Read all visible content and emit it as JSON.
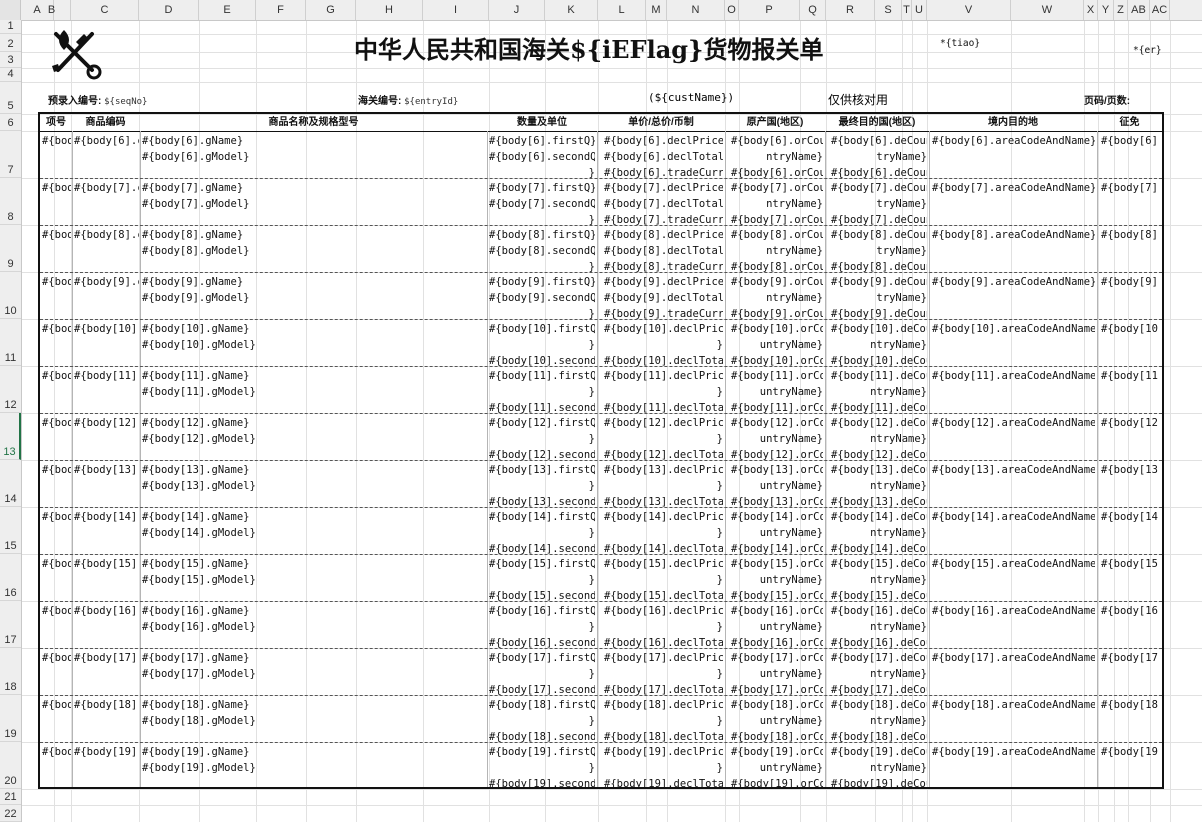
{
  "column_headers": [
    "A",
    "B",
    "C",
    "D",
    "E",
    "F",
    "G",
    "H",
    "I",
    "J",
    "K",
    "L",
    "M",
    "N",
    "O",
    "P",
    "Q",
    "R",
    "S",
    "T",
    "U",
    "V",
    "W",
    "X",
    "Y",
    "Z",
    "AB",
    "AC"
  ],
  "row_headers": [
    "1",
    "2",
    "3",
    "4",
    "5",
    "6",
    "7",
    "8",
    "9",
    "10",
    "11",
    "12",
    "13",
    "14",
    "15",
    "16",
    "17",
    "18",
    "19",
    "20",
    "21",
    "22"
  ],
  "selected_row": "13",
  "document": {
    "title": "中华人民共和国海关${iEFlag}货物报关单",
    "tiao": "*{tiao}",
    "er": "*{er}",
    "seq_label": "预录入编号:",
    "seq_value": "${seqNo}",
    "entry_label": "海关编号:",
    "entry_value": "${entryId}",
    "cust_name": "(${custName})",
    "verify_note": "仅供核对用",
    "page_label": "页码/页数:"
  },
  "table": {
    "headers": [
      "项号",
      "商品编码",
      "商品名称及规格型号",
      "数量及单位",
      "单价/总价/币制",
      "原产国(地区)",
      "最终目的国(地区)",
      "境内目的地",
      "征免"
    ],
    "rows": [
      {
        "c0": "#{bod",
        "c1": "#{body[6].c",
        "c2a": "#{body[6].gName}",
        "c2b": "#{body[6].gModel}",
        "c3a": "#{body[6].firstQ}",
        "c3b": "#{body[6].secondQ",
        "c3c": "}",
        "c4a": "#{body[6].declPrice}",
        "c4b": "#{body[6].declTotal}",
        "c4c": "#{body[6].tradeCurrN",
        "c5a": "#{body[6].orCou",
        "c5b": "ntryName}",
        "c5c": "#{body[6].orCou",
        "c6a": "#{body[6].deCoun",
        "c6b": "tryName}",
        "c6c": "#{body[6].deCoun",
        "c7": "#{body[6].areaCodeAndName}",
        "c8": "#{body[6]."
      },
      {
        "c0": "#{bod",
        "c1": "#{body[7].c",
        "c2a": "#{body[7].gName}",
        "c2b": "#{body[7].gModel}",
        "c3a": "#{body[7].firstQ}",
        "c3b": "#{body[7].secondQ",
        "c3c": "}",
        "c4a": "#{body[7].declPrice}",
        "c4b": "#{body[7].declTotal}",
        "c4c": "#{body[7].tradeCurrN",
        "c5a": "#{body[7].orCou",
        "c5b": "ntryName}",
        "c5c": "#{body[7].orCou",
        "c6a": "#{body[7].deCoun",
        "c6b": "tryName}",
        "c6c": "#{body[7].deCoun",
        "c7": "#{body[7].areaCodeAndName}",
        "c8": "#{body[7]."
      },
      {
        "c0": "#{bod",
        "c1": "#{body[8].c",
        "c2a": "#{body[8].gName}",
        "c2b": "#{body[8].gModel}",
        "c3a": "#{body[8].firstQ}",
        "c3b": "#{body[8].secondQ",
        "c3c": "}",
        "c4a": "#{body[8].declPrice}",
        "c4b": "#{body[8].declTotal}",
        "c4c": "#{body[8].tradeCurrN",
        "c5a": "#{body[8].orCou",
        "c5b": "ntryName}",
        "c5c": "#{body[8].orCou",
        "c6a": "#{body[8].deCoun",
        "c6b": "tryName}",
        "c6c": "#{body[8].deCoun",
        "c7": "#{body[8].areaCodeAndName}",
        "c8": "#{body[8]."
      },
      {
        "c0": "#{bod",
        "c1": "#{body[9].c",
        "c2a": "#{body[9].gName}",
        "c2b": "#{body[9].gModel}",
        "c3a": "#{body[9].firstQ}",
        "c3b": "#{body[9].secondQ",
        "c3c": "}",
        "c4a": "#{body[9].declPrice}",
        "c4b": "#{body[9].declTotal}",
        "c4c": "#{body[9].tradeCurrN",
        "c5a": "#{body[9].orCou",
        "c5b": "ntryName}",
        "c5c": "#{body[9].orCou",
        "c6a": "#{body[9].deCoun",
        "c6b": "tryName}",
        "c6c": "#{body[9].deCoun",
        "c7": "#{body[9].areaCodeAndName}",
        "c8": "#{body[9]."
      },
      {
        "c0": "#{bod",
        "c1": "#{body[10].",
        "c2a": "#{body[10].gName}",
        "c2b": "#{body[10].gModel}",
        "c3a": "#{body[10].firstQ",
        "c3b": "}",
        "c3c": "#{body[10].second",
        "c4a": "#{body[10].declPrice",
        "c4b": "}",
        "c4c": "#{body[10].declTotal",
        "c5a": "#{body[10].orCo",
        "c5b": "untryName}",
        "c5c": "#{body[10].orCo",
        "c6a": "#{body[10].deCou",
        "c6b": "ntryName}",
        "c6c": "#{body[10].deCou",
        "c7": "#{body[10].areaCodeAndName}",
        "c8": "#{body[10]."
      },
      {
        "c0": "#{bod",
        "c1": "#{body[11].",
        "c2a": "#{body[11].gName}",
        "c2b": "#{body[11].gModel}",
        "c3a": "#{body[11].firstQ",
        "c3b": "}",
        "c3c": "#{body[11].second",
        "c4a": "#{body[11].declPrice",
        "c4b": "}",
        "c4c": "#{body[11].declTotal",
        "c5a": "#{body[11].orCo",
        "c5b": "untryName}",
        "c5c": "#{body[11].orCo",
        "c6a": "#{body[11].deCou",
        "c6b": "ntryName}",
        "c6c": "#{body[11].deCou",
        "c7": "#{body[11].areaCodeAndName}",
        "c8": "#{body[11]."
      },
      {
        "c0": "#{bod",
        "c1": "#{body[12].",
        "c2a": "#{body[12].gName}",
        "c2b": "#{body[12].gModel}",
        "c3a": "#{body[12].firstQ",
        "c3b": "}",
        "c3c": "#{body[12].second",
        "c4a": "#{body[12].declPrice",
        "c4b": "}",
        "c4c": "#{body[12].declTotal",
        "c5a": "#{body[12].orCo",
        "c5b": "untryName}",
        "c5c": "#{body[12].orCo",
        "c6a": "#{body[12].deCou",
        "c6b": "ntryName}",
        "c6c": "#{body[12].deCou",
        "c7": "#{body[12].areaCodeAndName}",
        "c8": "#{body[12]."
      },
      {
        "c0": "#{bod",
        "c1": "#{body[13].",
        "c2a": "#{body[13].gName}",
        "c2b": "#{body[13].gModel}",
        "c3a": "#{body[13].firstQ",
        "c3b": "}",
        "c3c": "#{body[13].second",
        "c4a": "#{body[13].declPrice",
        "c4b": "}",
        "c4c": "#{body[13].declTotal",
        "c5a": "#{body[13].orCo",
        "c5b": "untryName}",
        "c5c": "#{body[13].orCo",
        "c6a": "#{body[13].deCou",
        "c6b": "ntryName}",
        "c6c": "#{body[13].deCou",
        "c7": "#{body[13].areaCodeAndName}",
        "c8": "#{body[13]."
      },
      {
        "c0": "#{bod",
        "c1": "#{body[14].",
        "c2a": "#{body[14].gName}",
        "c2b": "#{body[14].gModel}",
        "c3a": "#{body[14].firstQ",
        "c3b": "}",
        "c3c": "#{body[14].second",
        "c4a": "#{body[14].declPrice",
        "c4b": "}",
        "c4c": "#{body[14].declTotal",
        "c5a": "#{body[14].orCo",
        "c5b": "untryName}",
        "c5c": "#{body[14].orCo",
        "c6a": "#{body[14].deCou",
        "c6b": "ntryName}",
        "c6c": "#{body[14].deCou",
        "c7": "#{body[14].areaCodeAndName}",
        "c8": "#{body[14]."
      },
      {
        "c0": "#{bod",
        "c1": "#{body[15].",
        "c2a": "#{body[15].gName}",
        "c2b": "#{body[15].gModel}",
        "c3a": "#{body[15].firstQ",
        "c3b": "}",
        "c3c": "#{body[15].second",
        "c4a": "#{body[15].declPrice",
        "c4b": "}",
        "c4c": "#{body[15].declTotal",
        "c5a": "#{body[15].orCo",
        "c5b": "untryName}",
        "c5c": "#{body[15].orCo",
        "c6a": "#{body[15].deCou",
        "c6b": "ntryName}",
        "c6c": "#{body[15].deCou",
        "c7": "#{body[15].areaCodeAndName}",
        "c8": "#{body[15]."
      },
      {
        "c0": "#{bod",
        "c1": "#{body[16].",
        "c2a": "#{body[16].gName}",
        "c2b": "#{body[16].gModel}",
        "c3a": "#{body[16].firstQ",
        "c3b": "}",
        "c3c": "#{body[16].second",
        "c4a": "#{body[16].declPrice",
        "c4b": "}",
        "c4c": "#{body[16].declTotal",
        "c5a": "#{body[16].orCo",
        "c5b": "untryName}",
        "c5c": "#{body[16].orCo",
        "c6a": "#{body[16].deCou",
        "c6b": "ntryName}",
        "c6c": "#{body[16].deCou",
        "c7": "#{body[16].areaCodeAndName}",
        "c8": "#{body[16]."
      },
      {
        "c0": "#{bod",
        "c1": "#{body[17].",
        "c2a": "#{body[17].gName}",
        "c2b": "#{body[17].gModel}",
        "c3a": "#{body[17].firstQ",
        "c3b": "}",
        "c3c": "#{body[17].second",
        "c4a": "#{body[17].declPrice",
        "c4b": "}",
        "c4c": "#{body[17].declTotal",
        "c5a": "#{body[17].orCo",
        "c5b": "untryName}",
        "c5c": "#{body[17].orCo",
        "c6a": "#{body[17].deCou",
        "c6b": "ntryName}",
        "c6c": "#{body[17].deCou",
        "c7": "#{body[17].areaCodeAndName}",
        "c8": "#{body[17]."
      },
      {
        "c0": "#{bod",
        "c1": "#{body[18].",
        "c2a": "#{body[18].gName}",
        "c2b": "#{body[18].gModel}",
        "c3a": "#{body[18].firstQ",
        "c3b": "}",
        "c3c": "#{body[18].second",
        "c4a": "#{body[18].declPrice",
        "c4b": "}",
        "c4c": "#{body[18].declTotal",
        "c5a": "#{body[18].orCo",
        "c5b": "untryName}",
        "c5c": "#{body[18].orCo",
        "c6a": "#{body[18].deCou",
        "c6b": "ntryName}",
        "c6c": "#{body[18].deCou",
        "c7": "#{body[18].areaCodeAndName}",
        "c8": "#{body[18]."
      },
      {
        "c0": "#{bod",
        "c1": "#{body[19].",
        "c2a": "#{body[19].gName}",
        "c2b": "#{body[19].gModel}",
        "c3a": "#{body[19].firstQ",
        "c3b": "}",
        "c3c": "#{body[19].second",
        "c4a": "#{body[19].declPrice",
        "c4b": "}",
        "c4c": "#{body[19].declTotal",
        "c5a": "#{body[19].orCo",
        "c5b": "untryName}",
        "c5c": "#{body[19].orCo",
        "c6a": "#{body[19].deCou",
        "c6b": "ntryName}",
        "c6c": "#{body[19].deCou",
        "c7": "#{body[19].areaCodeAndName}",
        "c8": "#{body[19]."
      }
    ]
  }
}
